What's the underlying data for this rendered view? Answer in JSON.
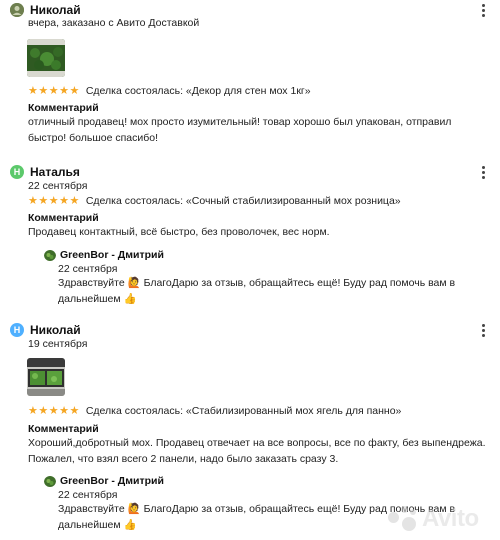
{
  "reviews": [
    {
      "author": "Николай",
      "avatar_letter": "",
      "avatar_color": "",
      "subtitle": "вчера, заказано с Авито Доставкой",
      "rating": 5,
      "deal": "Сделка состоялась: «Декор для стен мох 1кг»",
      "comment_label": "Комментарий",
      "comment_lines": [
        "отличный продавец! мох просто изумительный! товар хорошо был упакован, отправил",
        "быстро! большое спасибо!"
      ]
    },
    {
      "author": "Наталья",
      "avatar_letter": "Н",
      "avatar_color": "#5cc96b",
      "date": "22 сентября",
      "rating": 5,
      "deal": "Сделка состоялась: «Сочный стабилизированный мох розница»",
      "comment_label": "Комментарий",
      "comment_lines": [
        "Продавец контактный, всё быстро, без проволочек, вес норм."
      ],
      "reply": {
        "shop": "GreenBor - Дмитрий",
        "date": "22 сентября",
        "lines": [
          "Здравствуйте 🙋 БлагоДарю за отзыв, обращайтесь ещё! Буду рад помочь вам в",
          "дальнейшем 👍"
        ]
      }
    },
    {
      "author": "Николай",
      "avatar_letter": "Н",
      "avatar_color": "#4fb0ff",
      "date": "19 сентября",
      "rating": 5,
      "deal": "Сделка состоялась: «Стабилизированный мох ягель для панно»",
      "comment_label": "Комментарий",
      "comment_lines": [
        "Хороший,добротный мох. Продавец отвечает на все вопросы, все по факту, без выпендрежа.",
        "Пожалел, что взял всего 2 панели, надо было заказать сразу 3."
      ],
      "reply": {
        "shop": "GreenBor - Дмитрий",
        "date": "22 сентября",
        "lines": [
          "Здравствуйте 🙋 БлагоДарю за отзыв, обращайтесь ещё! Буду рад помочь вам в",
          "дальнейшем 👍"
        ]
      }
    }
  ],
  "stars_glyph": "★★★★★",
  "watermark": "Avito",
  "colors": {
    "star": "#f5a623",
    "accent_green": "#5cc96b",
    "accent_blue": "#4fb0ff"
  }
}
